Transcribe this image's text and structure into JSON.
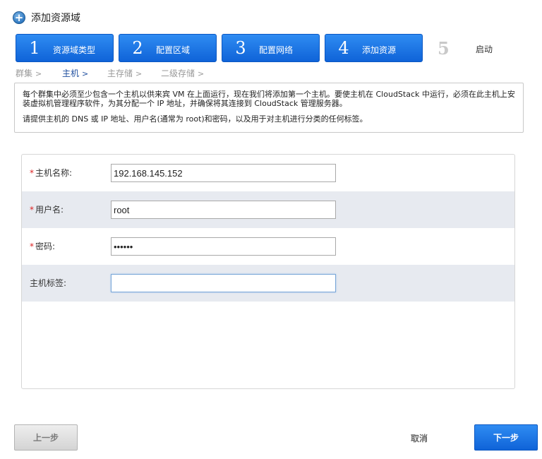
{
  "title": "添加资源域",
  "steps": [
    {
      "num": "1",
      "label": "资源域类型"
    },
    {
      "num": "2",
      "label": "配置区域"
    },
    {
      "num": "3",
      "label": "配置网络"
    },
    {
      "num": "4",
      "label": "添加资源"
    },
    {
      "num": "5",
      "label": "启动"
    }
  ],
  "subnav": [
    {
      "label": "群集",
      "active": false
    },
    {
      "label": "主机",
      "active": true
    },
    {
      "label": "主存储",
      "active": false
    },
    {
      "label": "二级存储",
      "active": false
    }
  ],
  "info": {
    "line1": "每个群集中必须至少包含一个主机以供来宾 VM 在上面运行，现在我们将添加第一个主机。要使主机在 CloudStack 中运行，必须在此主机上安装虚拟机管理程序软件，为其分配一个 IP 地址，并确保将其连接到 CloudStack 管理服务器。",
    "line2": "请提供主机的 DNS 或 IP 地址、用户名(通常为 root)和密码，以及用于对主机进行分类的任何标签。"
  },
  "form": {
    "hostname_label": "主机名称:",
    "hostname_value": "192.168.145.152",
    "username_label": "用户名:",
    "username_value": "root",
    "password_label": "密码:",
    "password_value": "••••••",
    "tags_label": "主机标签:",
    "tags_value": "",
    "required_mark": "*"
  },
  "buttons": {
    "prev": "上一步",
    "cancel": "取消",
    "next": "下一步"
  },
  "colors": {
    "step_active": "#1a73e8",
    "required": "#dd2222",
    "alt_row": "#e7eaf0"
  }
}
